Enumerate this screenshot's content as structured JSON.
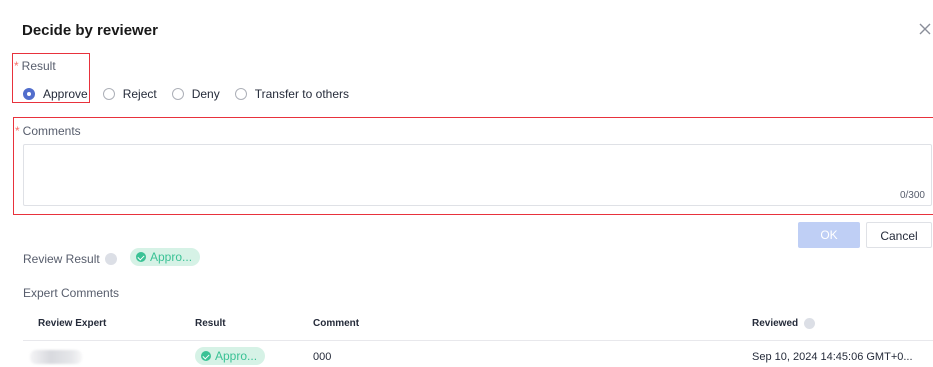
{
  "dialog": {
    "title": "Decide by reviewer"
  },
  "result_field": {
    "required_mark": "*",
    "label": "Result",
    "options": [
      {
        "label": "Approve",
        "checked": true
      },
      {
        "label": "Reject",
        "checked": false
      },
      {
        "label": "Deny",
        "checked": false
      },
      {
        "label": "Transfer to others",
        "checked": false
      }
    ]
  },
  "comments_field": {
    "required_mark": "*",
    "label": "Comments",
    "value": "",
    "counter": "0/300"
  },
  "buttons": {
    "ok": "OK",
    "cancel": "Cancel"
  },
  "review_summary": {
    "label": "Review Result",
    "badge": "Appro..."
  },
  "expert_comments": {
    "label": "Expert Comments",
    "columns": [
      "Review Expert",
      "Result",
      "Comment",
      "Reviewed"
    ],
    "rows": [
      {
        "result": "Appro...",
        "comment": "000",
        "reviewed": "Sep 10, 2024 14:45:06 GMT+0..."
      }
    ]
  },
  "colors": {
    "primary": "#526ecc",
    "ok_disabled": "#bfcff5",
    "success": "#3ac295",
    "annotation_border": "#e8323c"
  }
}
